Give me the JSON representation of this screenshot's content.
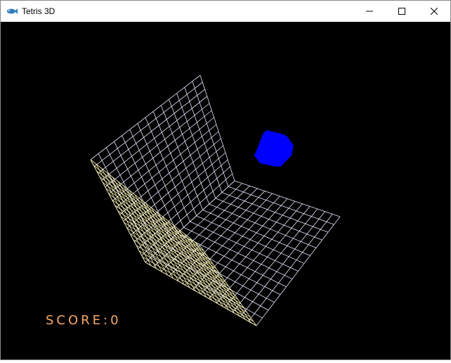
{
  "window": {
    "title": "Tetris 3D",
    "icon": "fish-app-icon",
    "controls": [
      "minimize-icon",
      "maximize-icon",
      "close-icon"
    ]
  },
  "scene": {
    "background_color": "#000000",
    "back_wall_color": "#e6e6ff",
    "floor_color": "#e6e6ff",
    "left_wall_color": "#fff7b3",
    "piece_color": "#0000ff"
  },
  "hud": {
    "score_text": "SCORE:0",
    "score_color": "#f6a869"
  }
}
